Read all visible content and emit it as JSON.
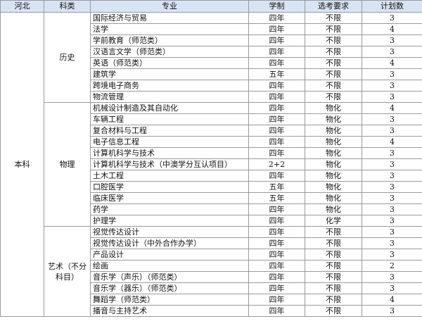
{
  "header": {
    "province": "河北",
    "subject": "科类",
    "major": "专业",
    "duration": "学制",
    "requirement": "选考要求",
    "quota": "计划数"
  },
  "level": "本科",
  "groups": [
    {
      "name": "历史",
      "rows": [
        {
          "major": "国际经济与贸易",
          "duration": "四年",
          "requirement": "不限",
          "quota": "3"
        },
        {
          "major": "法学",
          "duration": "四年",
          "requirement": "不限",
          "quota": "4"
        },
        {
          "major": "学前教育（师范类）",
          "duration": "四年",
          "requirement": "不限",
          "quota": "3"
        },
        {
          "major": "汉语言文学（师范类）",
          "duration": "四年",
          "requirement": "不限",
          "quota": "3"
        },
        {
          "major": "英语（师范类）",
          "duration": "四年",
          "requirement": "不限",
          "quota": "4"
        },
        {
          "major": "建筑学",
          "duration": "五年",
          "requirement": "不限",
          "quota": "3"
        },
        {
          "major": "跨境电子商务",
          "duration": "四年",
          "requirement": "不限",
          "quota": "3"
        },
        {
          "major": "物流管理",
          "duration": "四年",
          "requirement": "不限",
          "quota": "3"
        }
      ]
    },
    {
      "name": "物理",
      "rows": [
        {
          "major": "机械设计制造及其自动化",
          "duration": "四年",
          "requirement": "物化",
          "quota": "4"
        },
        {
          "major": "车辆工程",
          "duration": "四年",
          "requirement": "物化",
          "quota": "3"
        },
        {
          "major": "复合材料与工程",
          "duration": "四年",
          "requirement": "物化",
          "quota": "3"
        },
        {
          "major": "电子信息工程",
          "duration": "四年",
          "requirement": "物化",
          "quota": "4"
        },
        {
          "major": "计算机科学与技术",
          "duration": "四年",
          "requirement": "物化",
          "quota": "3"
        },
        {
          "major": "计算机科学与技术（中澳学分互认项目）",
          "duration": "2+2",
          "requirement": "物化",
          "quota": "3"
        },
        {
          "major": "土木工程",
          "duration": "四年",
          "requirement": "物化",
          "quota": "3"
        },
        {
          "major": "口腔医学",
          "duration": "五年",
          "requirement": "物化",
          "quota": "3"
        },
        {
          "major": "临床医学",
          "duration": "五年",
          "requirement": "物化",
          "quota": "3"
        },
        {
          "major": "药学",
          "duration": "四年",
          "requirement": "物化",
          "quota": "3"
        },
        {
          "major": "护理学",
          "duration": "四年",
          "requirement": "化学",
          "quota": "3"
        }
      ]
    },
    {
      "name": "艺术（不分科目）",
      "rows": [
        {
          "major": "视觉传达设计",
          "duration": "四年",
          "requirement": "不限",
          "quota": "3"
        },
        {
          "major": "视觉传达设计（中外合作办学）",
          "duration": "四年",
          "requirement": "不限",
          "quota": "3"
        },
        {
          "major": "产品设计",
          "duration": "四年",
          "requirement": "不限",
          "quota": "3"
        },
        {
          "major": "绘画",
          "duration": "四年",
          "requirement": "不限",
          "quota": "2"
        },
        {
          "major": "音乐学（声乐）（师范类）",
          "duration": "四年",
          "requirement": "不限",
          "quota": "3"
        },
        {
          "major": "音乐学（器乐）（师范类）",
          "duration": "四年",
          "requirement": "不限",
          "quota": "3"
        },
        {
          "major": "舞蹈学（师范类）",
          "duration": "四年",
          "requirement": "不限",
          "quota": "4"
        },
        {
          "major": "播音与主持艺术",
          "duration": "四年",
          "requirement": "不限",
          "quota": "3"
        }
      ]
    }
  ]
}
